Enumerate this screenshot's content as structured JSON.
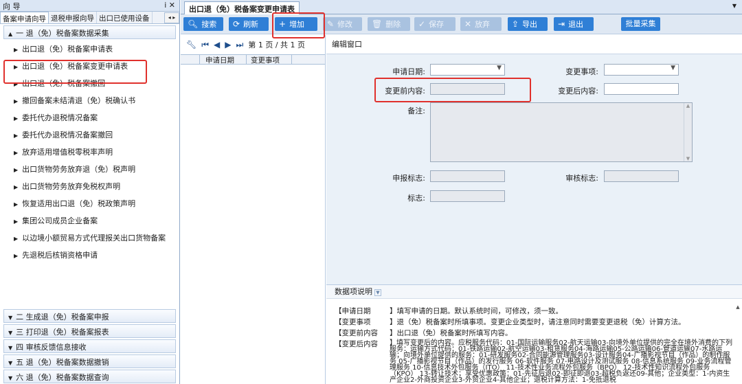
{
  "left_panel": {
    "title": "向 导",
    "pin": "ⅰ ✕",
    "tabs": [
      "备案申请向导",
      "退税申报向导",
      "出口已使用设备"
    ],
    "scroll_arrows": "◂ ▸",
    "group1": {
      "label": "一 退（免）税备案数据采集",
      "icon": "▲"
    },
    "items": [
      "出口退（免）税备案申请表",
      "出口退（免）税备案变更申请表",
      "出口退（免）税备案撤回",
      "撤回备案未结清退（免）税确认书",
      "委托代办退税情况备案",
      "委托代办退税情况备案撤回",
      "放弃适用增值税零税率声明",
      "出口货物劳务放弃退（免）税声明",
      "出口货物劳务放弃免税权声明",
      "恢复适用出口退（免）税政策声明",
      "集团公司成员企业备案",
      "以边境小额贸易方式代理报关出口货物备案",
      "先退税后核销资格申请"
    ],
    "groups_bottom": [
      "二 生成退（免）税备案申报",
      "三 打印退（免）税备案报表",
      "四 审核反馈信息接收",
      "五 退（免）税备案数据撤销",
      "六 退（免）税备案数据查询"
    ]
  },
  "document_tab": {
    "label": "出口退（免）税备案变更申请表",
    "caret": "▼"
  },
  "toolbar": {
    "search": "搜索",
    "refresh": "刷新",
    "add": "增加",
    "edit": "修改",
    "delete": "删除",
    "save": "保存",
    "abandon": "放弃",
    "export": "导出",
    "exit": "退出",
    "batch": "批量采集"
  },
  "pager": {
    "text": "第 1 页 / 共 1 页"
  },
  "grid": {
    "columns": [
      "申请日期",
      "变更事项"
    ]
  },
  "edit_window": {
    "title": "编辑窗口",
    "apply_date_label": "申请日期:",
    "change_item_label": "变更事项:",
    "before_label": "变更前内容:",
    "after_label": "变更后内容:",
    "remark_label": "备注:",
    "declare_flag_label": "申报标志:",
    "audit_flag_label": "审核标志:",
    "flag_label": "标志:"
  },
  "description": {
    "title": "数据项说明",
    "rows": [
      {
        "key": "【申请日期",
        "value": "】填写申请的日期。默认系统时间，可修改，须一致。"
      },
      {
        "key": "【变更事项",
        "value": "】退（免）税备案时所填事项。变更企业类型时，请注意同时需要变更退税（免）计算方法。"
      },
      {
        "key": "【变更前内容",
        "value": "】出口退（免）税备案时所填写内容。"
      },
      {
        "key": "【变更后内容",
        "value": "】填写变更后的内容。应税服务代码：01-国际运输服务02-航天运输03-向境外单位提供的完全在境外消费的下列服务：运输方式代码：01-铁路运输02-航空运输03-租赁服务04-海路运输05-公路运输06-管道运输07-水路运输；向境外单位提供的服务：01-研发服务02-合同能源管理服务03-设计服务04-广播影视节目（作品）的制作服务 05-广播影视节目（作品）的发行服务 06-软件服务 07-电路设计及测试服务 08-信息系统服务 09-业务流程管理服务 10-信息技术外包服务（ITO） 11-技术性业务流程外包服务（BPO） 12-技术性知识流程外包服务（KPO） 13-转让技术；享受优惠政策：01-先征后退02-即征即退03-超税负返还09-其他；企业类型：1-内资生产企业2-外商投资企业3-外贸企业4-其他企业；退税计算方法：1-免抵退税"
      }
    ]
  }
}
